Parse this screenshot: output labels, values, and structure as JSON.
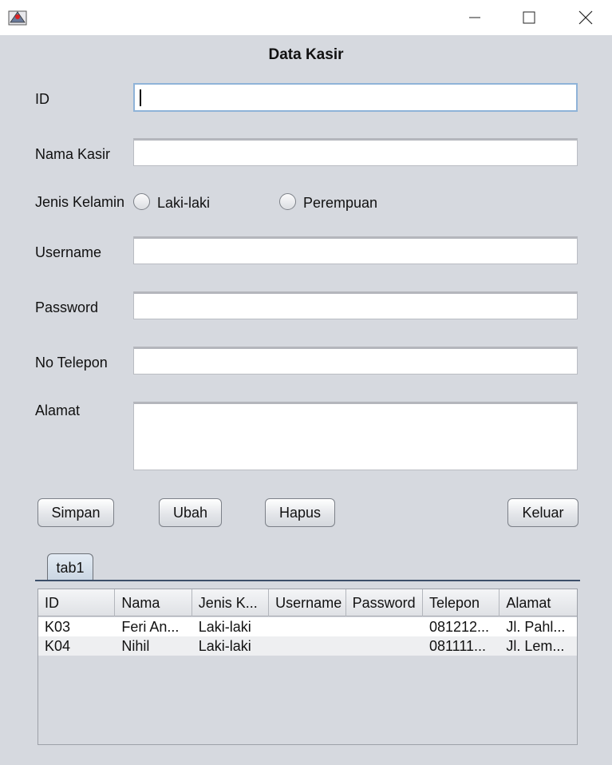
{
  "window": {
    "title": ""
  },
  "form": {
    "title": "Data Kasir",
    "id_label": "ID",
    "id_value": "",
    "nama_label": "Nama Kasir",
    "nama_value": "",
    "gender_label": "Jenis Kelamin",
    "gender_options": [
      "Laki-laki",
      "Perempuan"
    ],
    "username_label": "Username",
    "username_value": "",
    "password_label": "Password",
    "password_value": "",
    "telepon_label": "No Telepon",
    "telepon_value": "",
    "alamat_label": "Alamat",
    "alamat_value": ""
  },
  "buttons": {
    "simpan": "Simpan",
    "ubah": "Ubah",
    "hapus": "Hapus",
    "keluar": "Keluar"
  },
  "tabs": [
    {
      "label": "tab1"
    }
  ],
  "table": {
    "columns": [
      "ID",
      "Nama",
      "Jenis K...",
      "Username",
      "Password",
      "Telepon",
      "Alamat"
    ],
    "rows": [
      [
        "K03",
        "Feri An...",
        "Laki-laki",
        "",
        "",
        "081212...",
        "Jl. Pahl..."
      ],
      [
        "K04",
        "Nihil",
        "Laki-laki",
        "",
        "",
        "081111...",
        "Jl. Lem..."
      ]
    ]
  }
}
